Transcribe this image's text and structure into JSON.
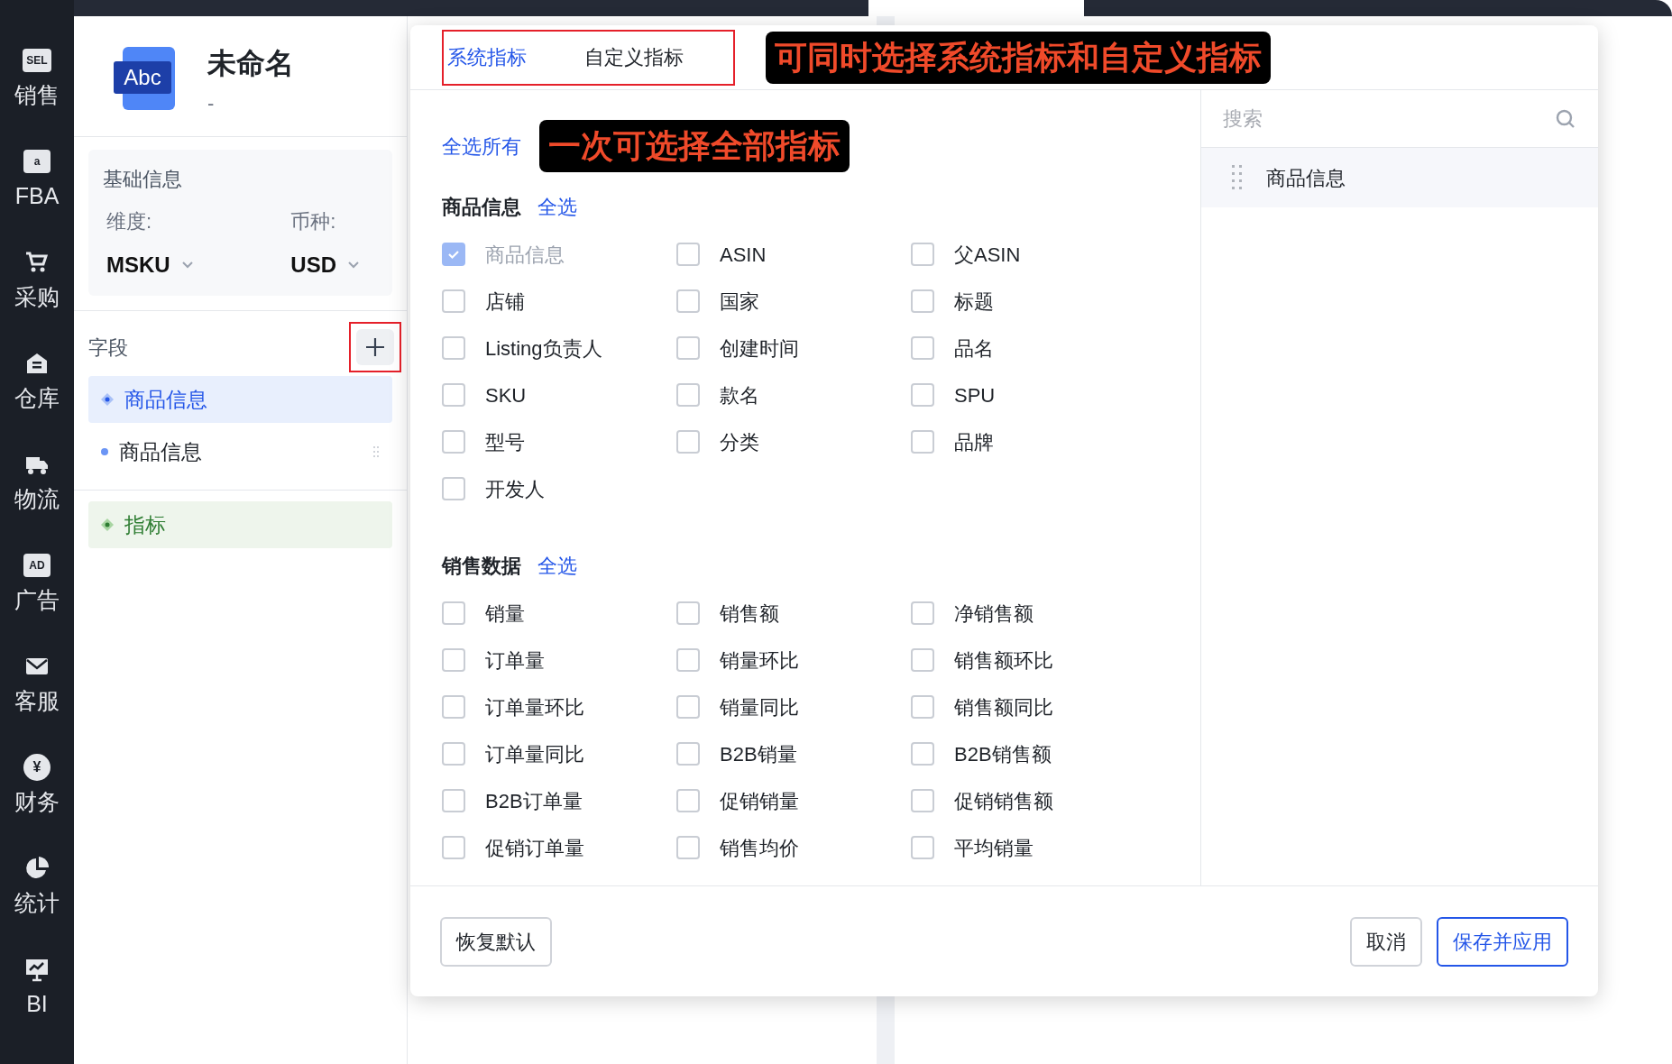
{
  "sidebar": {
    "items": [
      {
        "label": "销售",
        "badge": "SEL",
        "selected": false
      },
      {
        "label": "FBA",
        "badge": "a",
        "selected": false
      },
      {
        "label": "采购",
        "selected": false
      },
      {
        "label": "仓库",
        "selected": false
      },
      {
        "label": "物流",
        "selected": false
      },
      {
        "label": "广告",
        "badge": "AD",
        "selected": false
      },
      {
        "label": "客服",
        "selected": false
      },
      {
        "label": "财务",
        "badge": "¥",
        "selected": false
      },
      {
        "label": "统计",
        "selected": false
      },
      {
        "label": "BI",
        "selected": false
      }
    ]
  },
  "left_panel": {
    "icon_text": "Abc",
    "title": "未命名",
    "subtitle": "-",
    "basic_info": {
      "title": "基础信息",
      "fields": [
        {
          "label": "维度:",
          "value": "MSKU"
        },
        {
          "label": "币种:",
          "value": "USD"
        }
      ]
    },
    "fields_section": {
      "title": "字段",
      "items": [
        {
          "label": "商品信息",
          "kind": "group",
          "selected": true
        },
        {
          "label": "商品信息",
          "kind": "item",
          "selected": false
        }
      ]
    },
    "metrics": {
      "label": "指标"
    }
  },
  "dialog": {
    "tabs": [
      {
        "label": "系统指标",
        "selected": true
      },
      {
        "label": "自定义指标",
        "selected": false
      }
    ],
    "select_all_link": "全选所有",
    "groups": [
      {
        "title": "商品信息",
        "select_all": "全选",
        "options": [
          {
            "label": "商品信息",
            "checked": true,
            "disabled": true
          },
          {
            "label": "ASIN",
            "checked": false,
            "disabled": false
          },
          {
            "label": "父ASIN",
            "checked": false,
            "disabled": false
          },
          {
            "label": "店铺",
            "checked": false,
            "disabled": false
          },
          {
            "label": "国家",
            "checked": false,
            "disabled": false
          },
          {
            "label": "标题",
            "checked": false,
            "disabled": false
          },
          {
            "label": "Listing负责人",
            "checked": false,
            "disabled": false
          },
          {
            "label": "创建时间",
            "checked": false,
            "disabled": false
          },
          {
            "label": "品名",
            "checked": false,
            "disabled": false
          },
          {
            "label": "SKU",
            "checked": false,
            "disabled": false
          },
          {
            "label": "款名",
            "checked": false,
            "disabled": false
          },
          {
            "label": "SPU",
            "checked": false,
            "disabled": false
          },
          {
            "label": "型号",
            "checked": false,
            "disabled": false
          },
          {
            "label": "分类",
            "checked": false,
            "disabled": false
          },
          {
            "label": "品牌",
            "checked": false,
            "disabled": false
          },
          {
            "label": "开发人",
            "checked": false,
            "disabled": false
          }
        ]
      },
      {
        "title": "销售数据",
        "select_all": "全选",
        "options": [
          {
            "label": "销量",
            "checked": false,
            "disabled": false
          },
          {
            "label": "销售额",
            "checked": false,
            "disabled": false
          },
          {
            "label": "净销售额",
            "checked": false,
            "disabled": false
          },
          {
            "label": "订单量",
            "checked": false,
            "disabled": false
          },
          {
            "label": "销量环比",
            "checked": false,
            "disabled": false
          },
          {
            "label": "销售额环比",
            "checked": false,
            "disabled": false
          },
          {
            "label": "订单量环比",
            "checked": false,
            "disabled": false
          },
          {
            "label": "销量同比",
            "checked": false,
            "disabled": false
          },
          {
            "label": "销售额同比",
            "checked": false,
            "disabled": false
          },
          {
            "label": "订单量同比",
            "checked": false,
            "disabled": false
          },
          {
            "label": "B2B销量",
            "checked": false,
            "disabled": false
          },
          {
            "label": "B2B销售额",
            "checked": false,
            "disabled": false
          },
          {
            "label": "B2B订单量",
            "checked": false,
            "disabled": false
          },
          {
            "label": "促销销量",
            "checked": false,
            "disabled": false
          },
          {
            "label": "促销销售额",
            "checked": false,
            "disabled": false
          },
          {
            "label": "促销订单量",
            "checked": false,
            "disabled": false
          },
          {
            "label": "销售均价",
            "checked": false,
            "disabled": false
          },
          {
            "label": "平均销量",
            "checked": false,
            "disabled": false
          }
        ]
      }
    ],
    "search": {
      "placeholder": "搜索"
    },
    "selected_items": [
      {
        "label": "商品信息"
      }
    ],
    "buttons": {
      "reset": "恢复默认",
      "cancel": "取消",
      "save": "保存并应用"
    }
  },
  "annotations": [
    {
      "text": "可同时选择系统指标和自定义指标"
    },
    {
      "text": "一次可选择全部指标"
    }
  ]
}
